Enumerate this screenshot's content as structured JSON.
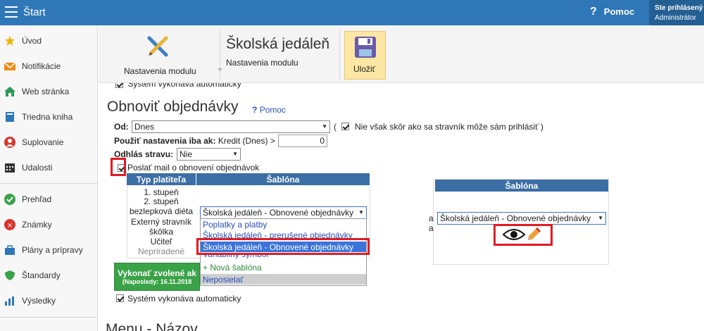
{
  "topbar": {
    "title": "Štart",
    "help": "Pomoc",
    "user_line1": "Ste prihlásený",
    "user_line2": "Administrátor"
  },
  "sidebar": {
    "items": [
      {
        "label": "Úvod",
        "icon": "star-icon",
        "color": "#f0b400"
      },
      {
        "label": "Notifikácie",
        "icon": "envelope-icon",
        "color": "#f08c1a"
      },
      {
        "label": "Web stránka",
        "icon": "home-icon",
        "color": "#2e9a5a"
      },
      {
        "label": "Triedna kniha",
        "icon": "book-icon",
        "color": "#2f77b7"
      },
      {
        "label": "Suplovanie",
        "icon": "user-icon",
        "color": "#d9342b"
      },
      {
        "label": "Udalosti",
        "icon": "calendar-icon",
        "color": "#333333"
      },
      {
        "label": "Prehľad",
        "icon": "check-circle-icon",
        "color": "#3aa247"
      },
      {
        "label": "Známky",
        "icon": "grade-icon",
        "color": "#d9342b"
      },
      {
        "label": "Plány a prípravy",
        "icon": "briefcase-icon",
        "color": "#2f77b7"
      },
      {
        "label": "Štandardy",
        "icon": "shield-icon",
        "color": "#3aa247"
      },
      {
        "label": "Výsledky",
        "icon": "bar-chart-icon",
        "color": "#2f77b7"
      }
    ]
  },
  "ribbon": {
    "settings_label": "Nastavenia modulu",
    "module_title": "Školská jedáleň",
    "module_sub": "Nastavenia modulu",
    "save_label": "Uložiť"
  },
  "main": {
    "cut_top": "Systém vykonáva automaticky",
    "section_title": "Obnoviť objednávky",
    "section_help": "Pomoc",
    "od_label": "Od:",
    "od_value": "Dnes",
    "paren_open": "(",
    "paren_text": "Nie však skôr ako sa stravník môže sám prihlásiť )",
    "credit_label_bold": "Použiť nastavenia iba ak:",
    "credit_label": "Kredit (Dnes) >",
    "credit_value": "0",
    "odhlas_label": "Odhlás stravu:",
    "odhlas_value": "Nie",
    "mail_label": "Poslať mail o obnovení objednávok",
    "col_type": "Typ platiteľa",
    "col_template": "Šablóna",
    "payer_types": [
      "1. stupeň",
      "2. stupeň",
      "bezlepková diéta",
      "Externý stravník",
      "škôlka",
      "Učiteľ",
      "Nepriradené"
    ],
    "template_selected": "Školská jedáleň - Obnovené objednávky",
    "dropdown_options": [
      "Poplatky a platby",
      "Školská jedáleň - prerušené objednávky",
      "Školská jedáleň - Obnovené objednávky",
      "Variabilný symbol",
      "+ Nová šablóna",
      "Neposielať"
    ],
    "run_button_line1": "Vykonať zvolené ak",
    "run_button_line2": "(Naposledy: 16.11.2018",
    "auto_label": "Systém vykonáva automaticky",
    "right_col_template": "Šablóna",
    "right_template_selected": "Školská jedáleň - Obnovené objednávky",
    "right_edge_a": "a",
    "right_edge_b": "a",
    "next_title": "Menu - Názov"
  },
  "colors": {
    "topbar": "#2f77b7",
    "table_header": "#3b6ea5",
    "green": "#3aa247",
    "highlight": "#e01b24",
    "selected_option": "#3b73d8"
  }
}
